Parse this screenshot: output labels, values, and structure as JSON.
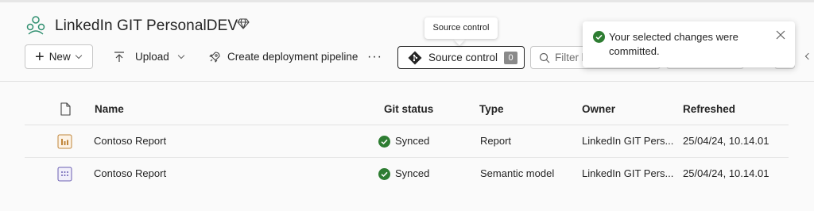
{
  "workspace": {
    "title": "LinkedIn GIT PersonalDEV"
  },
  "toolbar": {
    "new_label": "New",
    "upload_label": "Upload",
    "pipeline_label": "Create deployment pipeline",
    "more_label": "···",
    "source_control_label": "Source control",
    "source_control_count": "0",
    "search_placeholder": "Filter by keyword"
  },
  "tooltip": {
    "text": "Source control"
  },
  "toast": {
    "message": "Your selected changes were committed."
  },
  "table": {
    "columns": {
      "name": "Name",
      "git_status": "Git status",
      "type": "Type",
      "owner": "Owner",
      "refreshed": "Refreshed"
    },
    "rows": [
      {
        "name": "Contoso Report",
        "git_status": "Synced",
        "type": "Report",
        "owner": "LinkedIn GIT Pers...",
        "refreshed": "25/04/24, 10.14.01",
        "icon": "report-icon"
      },
      {
        "name": "Contoso Report",
        "git_status": "Synced",
        "type": "Semantic model",
        "owner": "LinkedIn GIT Pers...",
        "refreshed": "25/04/24, 10.14.01",
        "icon": "semantic-model-icon"
      }
    ]
  },
  "colors": {
    "synced": "#2e7d32",
    "badge": "#8a8a8a",
    "report_icon": "#c0853a",
    "model_icon": "#6b5fb3"
  }
}
